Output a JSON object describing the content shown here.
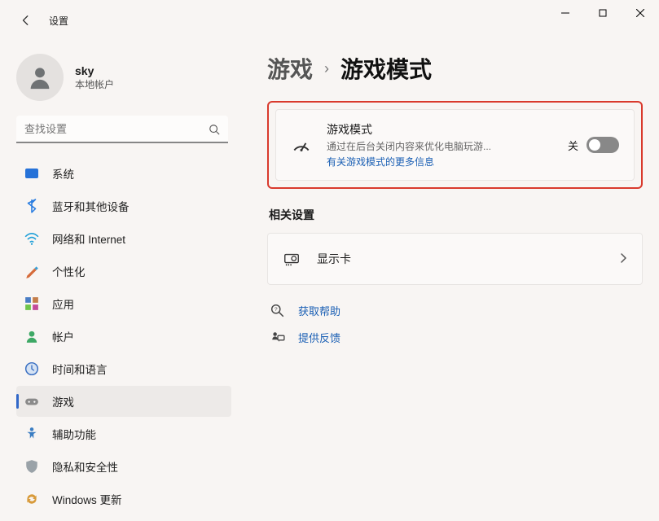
{
  "window": {
    "title": "设置"
  },
  "user": {
    "name": "sky",
    "account_type": "本地帐户"
  },
  "search": {
    "placeholder": "查找设置"
  },
  "nav": {
    "items": [
      {
        "label": "系统"
      },
      {
        "label": "蓝牙和其他设备"
      },
      {
        "label": "网络和 Internet"
      },
      {
        "label": "个性化"
      },
      {
        "label": "应用"
      },
      {
        "label": "帐户"
      },
      {
        "label": "时间和语言"
      },
      {
        "label": "游戏"
      },
      {
        "label": "辅助功能"
      },
      {
        "label": "隐私和安全性"
      },
      {
        "label": "Windows 更新"
      }
    ]
  },
  "breadcrumb": {
    "parent": "游戏",
    "current": "游戏模式"
  },
  "game_mode_card": {
    "title": "游戏模式",
    "description": "通过在后台关闭内容来优化电脑玩游...",
    "link": "有关游戏模式的更多信息",
    "toggle_value": "关"
  },
  "related": {
    "heading": "相关设置",
    "display_adapter": "显示卡"
  },
  "links": {
    "get_help": "获取帮助",
    "feedback": "提供反馈"
  }
}
